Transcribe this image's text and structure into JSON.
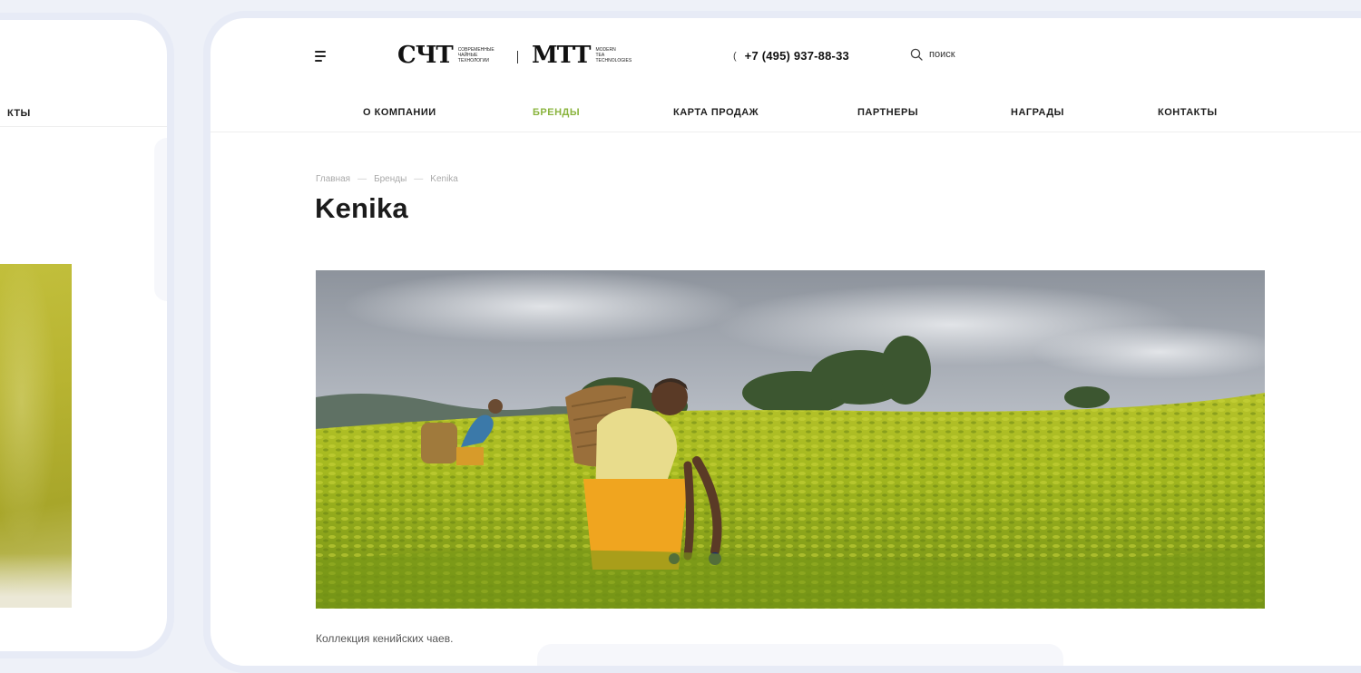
{
  "left_frame": {
    "nav_fragment": "КТЫ"
  },
  "header": {
    "logo_sct": {
      "mark": "СЧТ",
      "sub": [
        "СОВРЕМЕННЫЕ",
        "ЧАЙНЫЕ",
        "ТЕХНОЛОГИИ"
      ]
    },
    "logo_mtt": {
      "mark": "МТТ",
      "sub": [
        "MODERN",
        "TEA",
        "TECHNOLOGIES"
      ]
    },
    "phone": "+7 (495) 937-88-33",
    "search_placeholder": "поиск"
  },
  "nav": {
    "items": [
      {
        "label": "О КОМПАНИИ",
        "active": false
      },
      {
        "label": "БРЕНДЫ",
        "active": true
      },
      {
        "label": "КАРТА ПРОДАЖ",
        "active": false
      },
      {
        "label": "ПАРТНЕРЫ",
        "active": false
      },
      {
        "label": "НАГРАДЫ",
        "active": false
      },
      {
        "label": "КОНТАКТЫ",
        "active": false
      }
    ],
    "active_color": "#8ab43e"
  },
  "breadcrumb": {
    "items": [
      "Главная",
      "Бренды",
      "Kenika"
    ],
    "separator": "—"
  },
  "page": {
    "title": "Kenika",
    "description": "Коллекция кенийских чаев."
  }
}
